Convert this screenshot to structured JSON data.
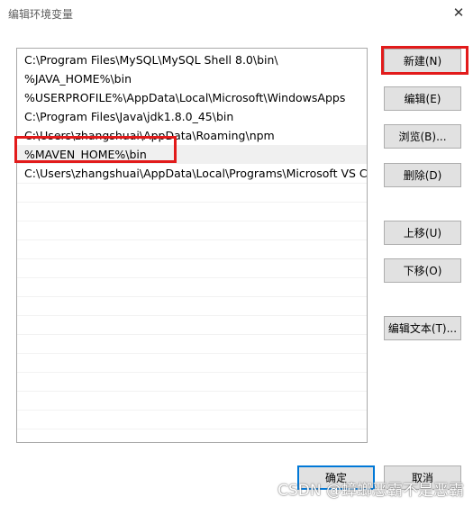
{
  "window": {
    "title": "编辑环境变量",
    "close_glyph": "✕"
  },
  "paths": [
    "C:\\Program Files\\MySQL\\MySQL Shell 8.0\\bin\\",
    "%JAVA_HOME%\\bin",
    "%USERPROFILE%\\AppData\\Local\\Microsoft\\WindowsApps",
    "C:\\Program Files\\Java\\jdk1.8.0_45\\bin",
    "C:\\Users\\zhangshuai\\AppData\\Roaming\\npm",
    "%MAVEN_HOME%\\bin",
    "C:\\Users\\zhangshuai\\AppData\\Local\\Programs\\Microsoft VS C..."
  ],
  "selected_path": "%MAVEN_HOME%\\bin",
  "buttons": {
    "new": "新建(N)",
    "edit": "编辑(E)",
    "browse": "浏览(B)...",
    "delete": "删除(D)",
    "move_up": "上移(U)",
    "move_down": "下移(O)",
    "edit_text": "编辑文本(T)...",
    "ok": "确定",
    "cancel": "取消"
  },
  "watermark": "CSDN @蟑螂恶霸不是恶霸",
  "colors": {
    "highlight": "#e21b1b",
    "selected_row": "#f0f0f0",
    "button_face": "#e1e1e1",
    "focus_border": "#0078d7"
  }
}
